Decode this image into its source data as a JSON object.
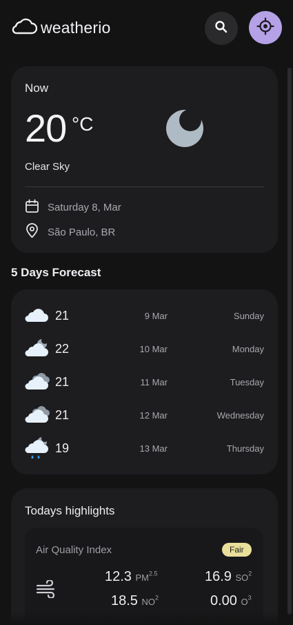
{
  "app": {
    "name": "weatherio",
    "icons": {
      "logo": "cloud-icon",
      "search": "search-icon",
      "location": "current-location-icon"
    },
    "colors": {
      "accent": "#b5a1e6",
      "background": "#131314",
      "card": "#1d1c1f",
      "aqi_fair": "#e9de9a"
    }
  },
  "current": {
    "title": "Now",
    "temperature": "20",
    "unit": "°C",
    "condition": "Clear Sky",
    "condition_icon": "moon-icon",
    "date": "Saturday 8, Mar",
    "location": "São Paulo, BR"
  },
  "forecast": {
    "title": "5 Days Forecast",
    "days": [
      {
        "temp": "21",
        "date": "9 Mar",
        "day": "Sunday",
        "icon": "cloud-icon"
      },
      {
        "temp": "22",
        "date": "10 Mar",
        "day": "Monday",
        "icon": "cloud-moon-icon"
      },
      {
        "temp": "21",
        "date": "11 Mar",
        "day": "Tuesday",
        "icon": "overcast-icon"
      },
      {
        "temp": "21",
        "date": "12 Mar",
        "day": "Wednesday",
        "icon": "overcast-icon"
      },
      {
        "temp": "19",
        "date": "13 Mar",
        "day": "Thursday",
        "icon": "rain-moon-icon"
      }
    ]
  },
  "highlights": {
    "title": "Todays highlights",
    "aqi": {
      "title": "Air Quality Index",
      "badge": "Fair",
      "pm25": {
        "value": "12.3",
        "label": "PM",
        "sub": "2.5"
      },
      "so2": {
        "value": "16.9",
        "label": "SO",
        "sub": "2"
      },
      "no2": {
        "value": "18.5",
        "label": "NO",
        "sub": "2"
      },
      "o3": {
        "value": "0.00",
        "label": "O",
        "sub": "3"
      }
    }
  }
}
